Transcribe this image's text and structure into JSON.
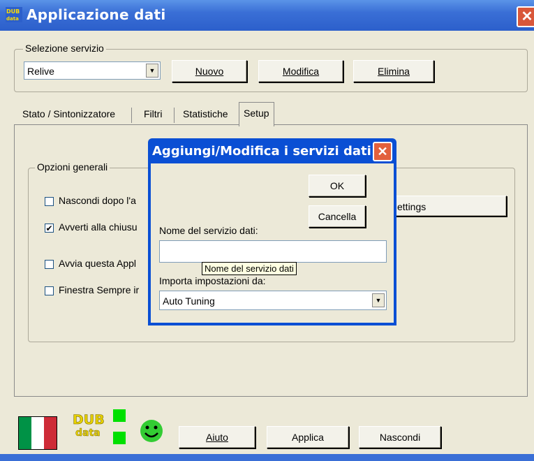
{
  "window": {
    "title": "Applicazione dati",
    "close": "✕"
  },
  "service_group": {
    "legend": "Selezione servizio",
    "selected": "Relive",
    "buttons": {
      "new": "Nuovo",
      "modify": "Modifica",
      "delete": "Elimina"
    }
  },
  "tabs": [
    {
      "label": "Stato / Sintonizzatore"
    },
    {
      "label": "Filtri"
    },
    {
      "label": "Statistiche"
    },
    {
      "label": "Setup"
    }
  ],
  "options_group": {
    "legend": "Opzioni generali",
    "items": [
      {
        "label": "Nascondi dopo l'a",
        "checked": false
      },
      {
        "label": "Avverti alla chiusu",
        "checked": true
      },
      {
        "label": "Avvia questa Appl",
        "checked": false
      },
      {
        "label": "Finestra Sempre ir",
        "checked": false
      }
    ],
    "settings_button": "ettings"
  },
  "dialog": {
    "title": "Aggiungi/Modifica i servizi dati",
    "close": "✕",
    "ok": "OK",
    "cancel": "Cancella",
    "name_label": "Nome del servizio dati:",
    "name_value": "",
    "tooltip": "Nome del servizio dati",
    "import_label": "Importa impostazioni da:",
    "import_selected": "Auto Tuning"
  },
  "footer": {
    "logo_top": "DUB",
    "logo_bottom": "data",
    "buttons": {
      "help": "Aiuto",
      "apply": "Applica",
      "hide": "Nascondi"
    }
  },
  "colors": {
    "titlebar": "#3a6fd6",
    "dialog_border": "#0a4fd4",
    "status_green": "#00e000",
    "smiley": "#33cc33"
  }
}
